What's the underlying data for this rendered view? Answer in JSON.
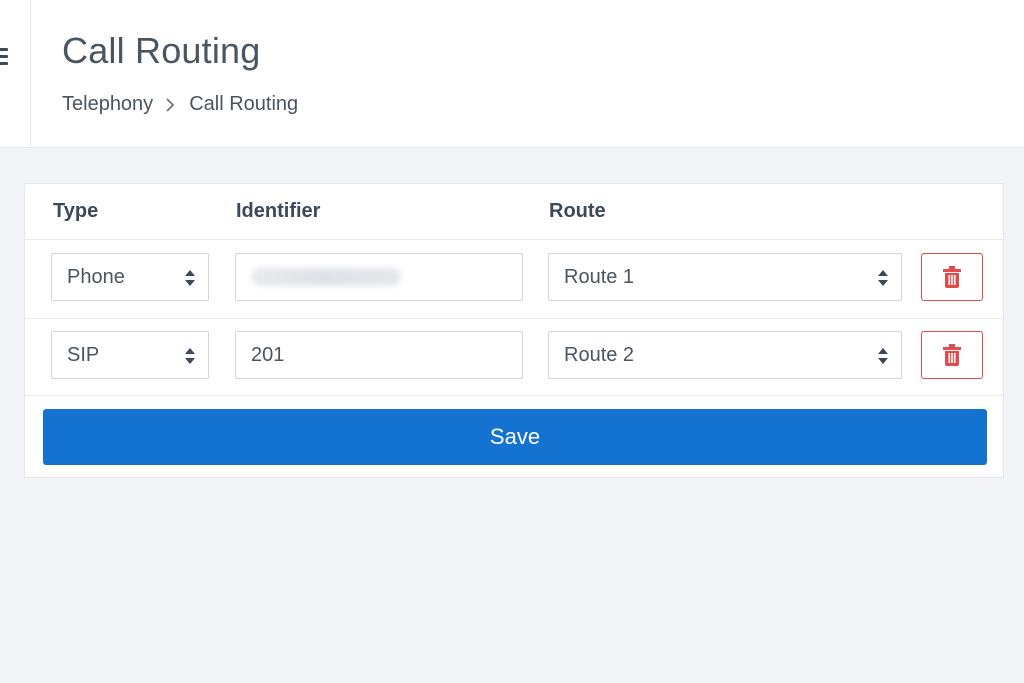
{
  "header": {
    "title": "Call Routing",
    "breadcrumb": [
      {
        "label": "Telephony"
      },
      {
        "label": "Call Routing"
      }
    ]
  },
  "table": {
    "columns": {
      "type": "Type",
      "identifier": "Identifier",
      "route": "Route"
    },
    "rows": [
      {
        "type": "Phone",
        "identifier": "",
        "identifier_blurred": true,
        "route": "Route 1"
      },
      {
        "type": "SIP",
        "identifier": "201",
        "identifier_blurred": false,
        "route": "Route 2"
      }
    ]
  },
  "actions": {
    "save_label": "Save"
  },
  "colors": {
    "primary": "#1473d1",
    "danger": "#e24b4b",
    "text": "#4a5562",
    "background": "#f2f4f8"
  },
  "icons": {
    "menu": "hamburger-icon",
    "breadcrumb_separator": "chevron-right-icon",
    "select_arrows": "sort-arrows-icon",
    "delete": "trash-icon"
  }
}
